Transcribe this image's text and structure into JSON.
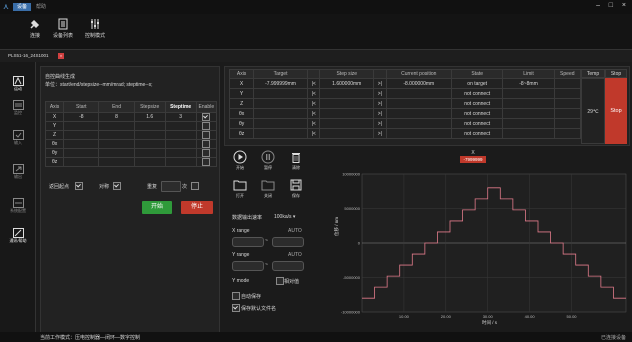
{
  "titlebar": {
    "menus": [
      "设备",
      "帮助"
    ],
    "window_controls": [
      "–",
      "□",
      "×"
    ]
  },
  "toolbar": {
    "items": [
      {
        "label": "连接",
        "icon": "connect-icon"
      },
      {
        "label": "设备列表",
        "icon": "device-list-icon"
      },
      {
        "label": "控制模式",
        "icon": "control-mode-icon"
      }
    ]
  },
  "device_tab": {
    "label": "PLS51-16_24S1001"
  },
  "sidebar": {
    "items": [
      {
        "label": "运动",
        "icon": "motion-icon",
        "active": true
      },
      {
        "label": "监控",
        "icon": "monitor-icon",
        "active": false
      },
      {
        "label": "输入",
        "icon": "input-icon",
        "active": false
      },
      {
        "label": "输出",
        "icon": "output-icon",
        "active": false
      },
      {
        "label": "系统配置",
        "icon": "config-icon",
        "active": false
      },
      {
        "label": "通讯/帮助",
        "icon": "comm-icon",
        "active": true
      }
    ]
  },
  "trajectory": {
    "title": "自控曲线生成",
    "hint": "单位：start/end/stepsize--mm/mrad; steptime--s;",
    "headers": [
      "Axis",
      "Start",
      "End",
      "Stepsize",
      "Steptime",
      "Enable"
    ],
    "rows": [
      {
        "axis": "X",
        "start": "-8",
        "end": "8",
        "stepsize": "1.6",
        "steptime": "3",
        "enable": true
      },
      {
        "axis": "Y",
        "start": "",
        "end": "",
        "stepsize": "",
        "steptime": "",
        "enable": false
      },
      {
        "axis": "Z",
        "start": "",
        "end": "",
        "stepsize": "",
        "steptime": "",
        "enable": false
      },
      {
        "axis": "θx",
        "start": "",
        "end": "",
        "stepsize": "",
        "steptime": "",
        "enable": false
      },
      {
        "axis": "θy",
        "start": "",
        "end": "",
        "stepsize": "",
        "steptime": "",
        "enable": false
      },
      {
        "axis": "θz",
        "start": "",
        "end": "",
        "stepsize": "",
        "steptime": "",
        "enable": false
      }
    ],
    "return_origin_label": "返回起点",
    "reverse_label": "对称",
    "repeat_label": "重复",
    "repeat_unit": "次",
    "start_button": "开始",
    "stop_button": "停止"
  },
  "motion_table": {
    "headers": [
      "Axis",
      "Target",
      "",
      "Step size",
      "",
      "Current position",
      "State",
      "Limit",
      "Speed",
      "Temp",
      "Stop"
    ],
    "rows": [
      {
        "axis": "X",
        "target": "-7.999999mm",
        "step": "1.600000mm",
        "position": "-8.000000mm",
        "state": "on target",
        "limit": "-8~8mm"
      },
      {
        "axis": "Y",
        "target": "",
        "step": "",
        "position": "",
        "state": "not connect",
        "limit": ""
      },
      {
        "axis": "Z",
        "target": "",
        "step": "",
        "position": "",
        "state": "not connect",
        "limit": ""
      },
      {
        "axis": "θx",
        "target": "",
        "step": "",
        "position": "",
        "state": "not connect",
        "limit": ""
      },
      {
        "axis": "θy",
        "target": "",
        "step": "",
        "position": "",
        "state": "not connect",
        "limit": ""
      },
      {
        "axis": "θz",
        "target": "",
        "step": "",
        "position": "",
        "state": "not connect",
        "limit": ""
      }
    ],
    "temp": "29℃",
    "stop_label": "Stop",
    "step_left_glyph": "|<",
    "step_right_glyph": ">|"
  },
  "chart_controls": {
    "buttons": [
      {
        "label": "开始",
        "icon": "play-icon"
      },
      {
        "label": "暂停",
        "icon": "pause-icon"
      },
      {
        "label": "清除",
        "icon": "trash-icon"
      },
      {
        "label": "打开",
        "icon": "folder-open-icon"
      },
      {
        "label": "关闭",
        "icon": "folder-close-icon"
      },
      {
        "label": "保存",
        "icon": "save-icon"
      }
    ],
    "rate_label": "数据输出速率",
    "rate_value": "100ka/s",
    "x_range_label": "X range",
    "x_range_auto": "AUTO",
    "y_range_label": "Y range",
    "y_range_auto": "AUTO",
    "y_mode_label": "Y mode",
    "relative_label": "相对值",
    "auto_save_label": "自动保存",
    "save_default_label": "保存默认文件名",
    "range_sep": "~"
  },
  "chart_data": {
    "type": "line",
    "legend": [
      {
        "name": "X",
        "value": "-7999999"
      }
    ],
    "xlabel": "时间 / s",
    "ylabel": "位移 / nm",
    "xlim": [
      0,
      63
    ],
    "ylim": [
      -10000000,
      10000000
    ],
    "x_ticks": [
      "10.00",
      "20.00",
      "30.00",
      "40.00",
      "50.00"
    ],
    "y_ticks": [
      "10000000",
      "5000000",
      "0",
      "-5000000",
      "-10000000"
    ],
    "x": [
      0,
      3,
      3,
      6,
      6,
      9,
      9,
      12,
      12,
      15,
      15,
      18,
      18,
      21,
      21,
      24,
      24,
      27,
      27,
      30,
      30,
      33,
      33,
      36,
      36,
      39,
      39,
      42,
      42,
      45,
      45,
      48,
      48,
      51,
      51,
      54,
      54,
      57,
      57,
      60,
      60,
      63
    ],
    "y": [
      -8000000,
      -8000000,
      -6400000,
      -6400000,
      -4800000,
      -4800000,
      -3200000,
      -3200000,
      -1600000,
      -1600000,
      0,
      0,
      1600000,
      1600000,
      3200000,
      3200000,
      4800000,
      4800000,
      6400000,
      6400000,
      8000000,
      8000000,
      6400000,
      6400000,
      4800000,
      4800000,
      3200000,
      3200000,
      1600000,
      1600000,
      0,
      0,
      -1600000,
      -1600000,
      -3200000,
      -3200000,
      -4800000,
      -4800000,
      -6400000,
      -6400000,
      -8000000,
      -8000000
    ],
    "line_color": "#e07a8a",
    "grid": true
  },
  "status_bar": {
    "left": "当前工作模式：压电控制器—闭环—数字控制",
    "right": "已连接设备"
  },
  "colors": {
    "start_green": "#2f9a3a",
    "stop_red": "#c0392b",
    "accent_blue": "#3a6ea8"
  }
}
